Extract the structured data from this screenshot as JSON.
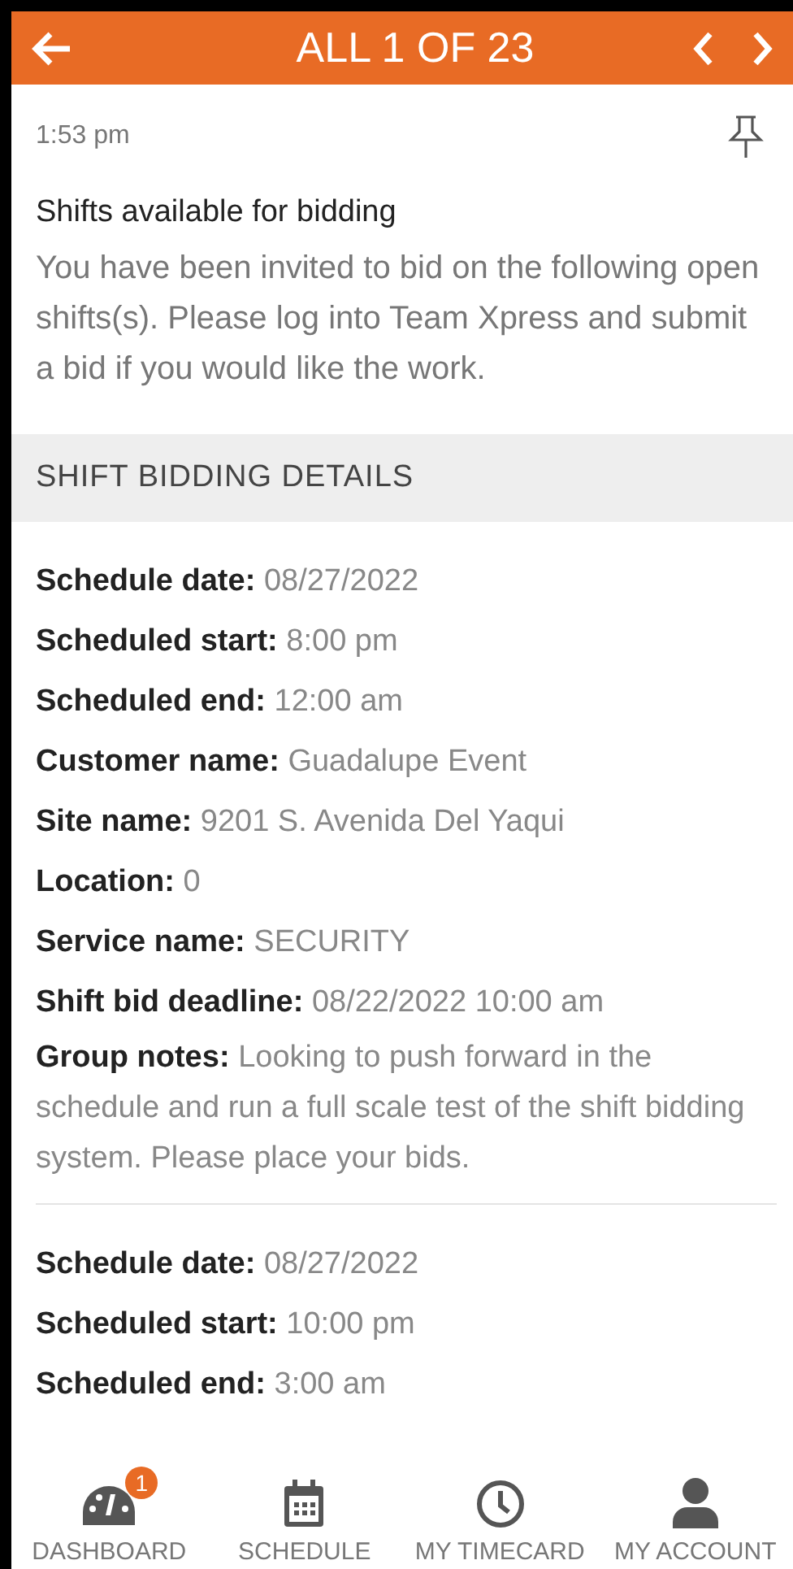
{
  "header": {
    "title": "ALL 1 OF 23"
  },
  "message": {
    "time": "1:53 pm",
    "pinned": false,
    "title": "Shifts available for bidding",
    "body": "You have been invited to bid on the following open shifts(s). Please log into Team Xpress and submit a bid if you would like the work."
  },
  "section": {
    "title": "SHIFT BIDDING DETAILS"
  },
  "shifts": [
    {
      "fields": [
        {
          "label": "Schedule date:",
          "value": "08/27/2022"
        },
        {
          "label": "Scheduled start:",
          "value": "8:00 pm"
        },
        {
          "label": "Scheduled end:",
          "value": "12:00 am"
        },
        {
          "label": "Customer name:",
          "value": "Guadalupe Event"
        },
        {
          "label": "Site name:",
          "value": "9201 S. Avenida Del Yaqui"
        },
        {
          "label": "Location:",
          "value": "0"
        },
        {
          "label": "Service name:",
          "value": "SECURITY"
        },
        {
          "label": "Shift bid deadline:",
          "value": "08/22/2022 10:00 am"
        },
        {
          "label": "Group notes:",
          "value": "Looking to push forward in the schedule and run a full scale test of the shift bidding system. Please place your bids."
        }
      ]
    },
    {
      "fields": [
        {
          "label": "Schedule date:",
          "value": "08/27/2022"
        },
        {
          "label": "Scheduled start:",
          "value": "10:00 pm"
        },
        {
          "label": "Scheduled end:",
          "value": "3:00 am"
        }
      ]
    }
  ],
  "nav": [
    {
      "kind": "dashboard",
      "label": "DASHBOARD",
      "badge": "1"
    },
    {
      "kind": "schedule",
      "label": "SCHEDULE"
    },
    {
      "kind": "timecard",
      "label": "MY TIMECARD"
    },
    {
      "kind": "account",
      "label": "MY ACCOUNT"
    }
  ]
}
